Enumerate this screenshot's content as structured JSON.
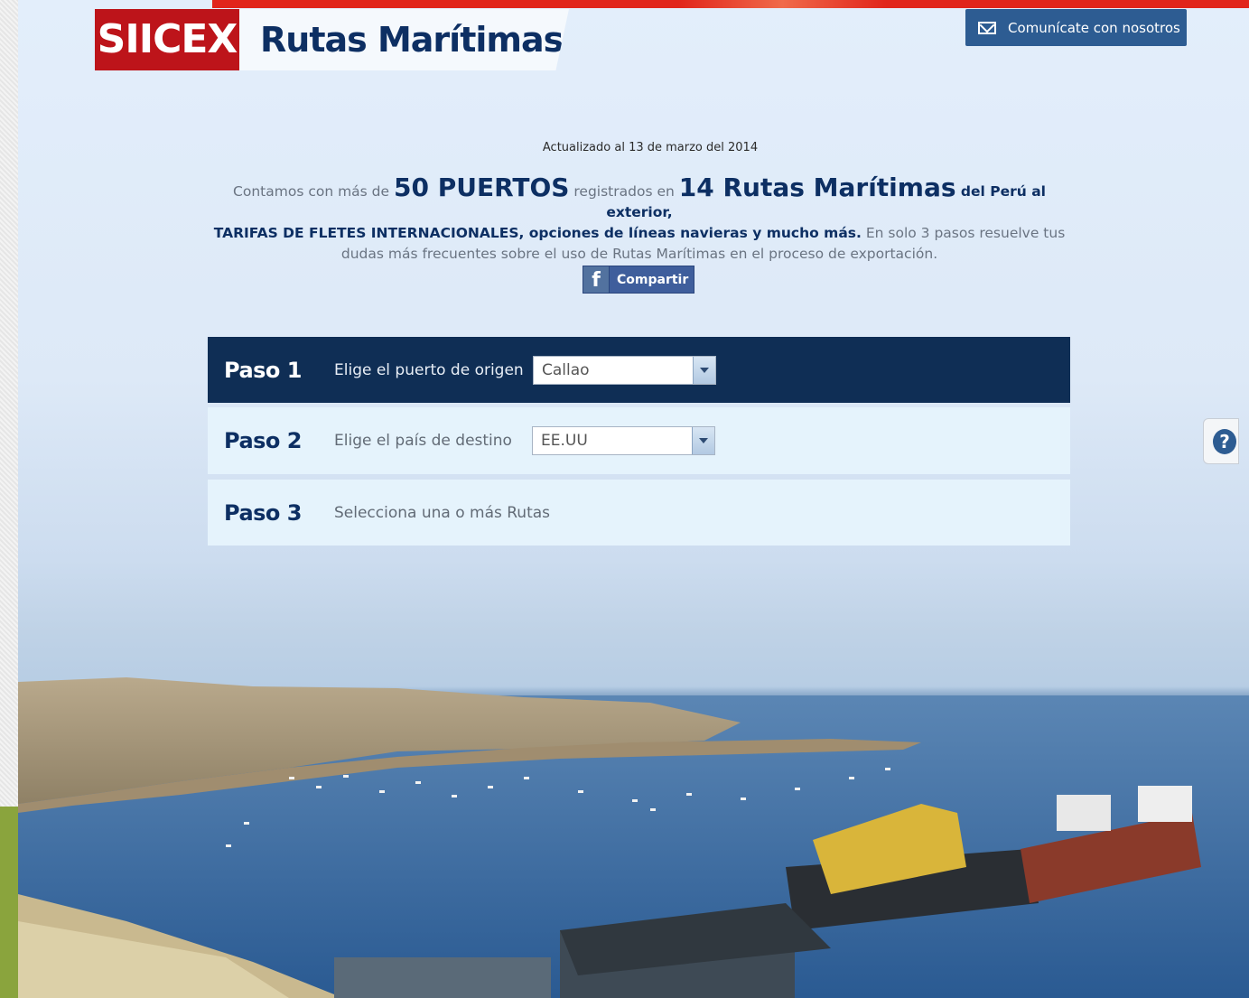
{
  "brand": {
    "short": "SIICEX",
    "title": "Rutas Marítimas"
  },
  "header": {
    "contact_label": "Comunícate con nosotros"
  },
  "updated_text": "Actualizado al 13 de marzo del 2014",
  "intro": {
    "part1": "Contamos con más de ",
    "ports": "50 PUERTOS",
    "part2": " registrados en ",
    "routes": "14 Rutas Marítimas",
    "part3": " del Perú al exterior,",
    "bold_line": "TARIFAS DE FLETES INTERNACIONALES, opciones de líneas navieras y mucho más.",
    "part4": " En solo 3 pasos resuelve tus dudas más frecuentes sobre el uso de Rutas Marítimas en el proceso de exportación."
  },
  "share": {
    "icon_letter": "f",
    "label": "Compartir"
  },
  "steps": [
    {
      "label": "Paso 1",
      "text": "Elige el puerto de origen",
      "selected": "Callao"
    },
    {
      "label": "Paso 2",
      "text": "Elige el país de destino",
      "selected": "EE.UU"
    },
    {
      "label": "Paso 3",
      "text": "Selecciona una o más Rutas"
    }
  ],
  "help": {
    "symbol": "?"
  },
  "colors": {
    "brand_red": "#bd141a",
    "navy": "#0d2f63",
    "step_active": "#0f2e55",
    "step_inactive": "#e5f3fc",
    "button_blue": "#2d5c92"
  }
}
